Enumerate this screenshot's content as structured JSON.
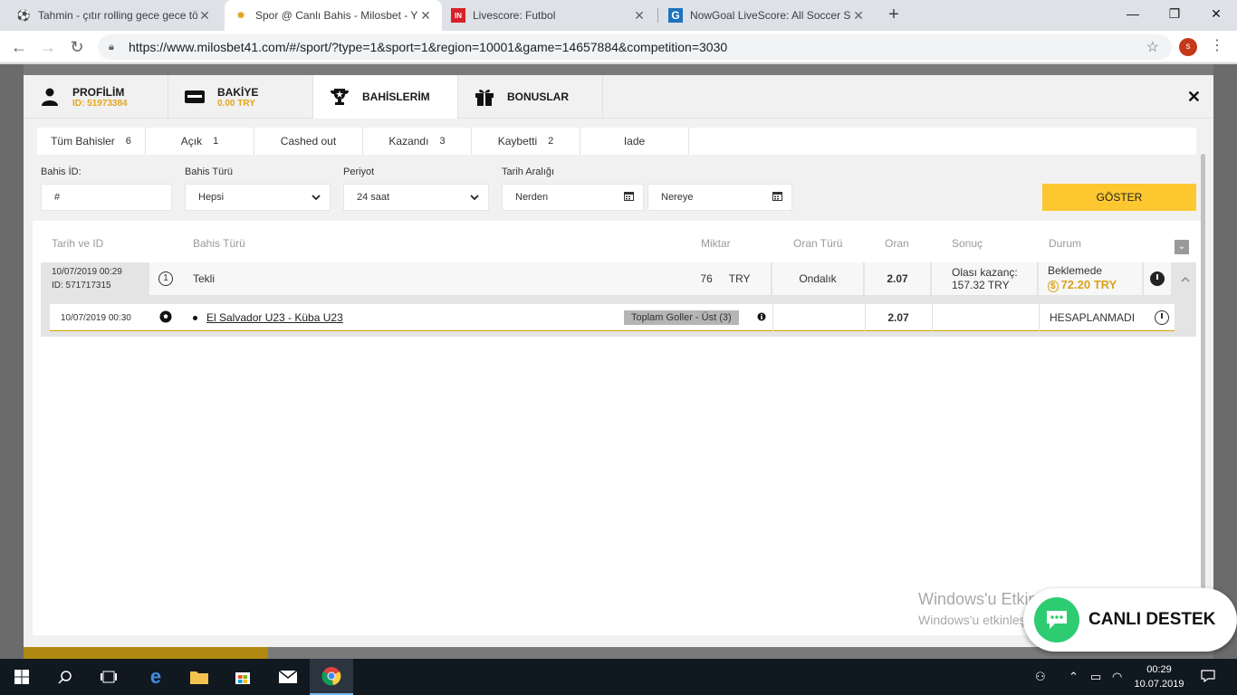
{
  "browser": {
    "tabs": [
      {
        "title": "Tahmin - çıtır rolling gece gece tö",
        "icon": "soccer-ball-icon"
      },
      {
        "title": "Spor @ Canlı Bahis - Milosbet - Y",
        "icon": "milosbet-logo-icon",
        "active": true
      },
      {
        "title": "Livescore: Futbol",
        "icon": "livescore-logo-icon"
      },
      {
        "title": "NowGoal LiveScore: All Soccer Sc",
        "icon": "nowgoal-logo-icon"
      }
    ],
    "url": "https://www.milosbet41.com/#/sport/?type=1&sport=1&region=10001&game=14657884&competition=3030",
    "profile_initial": "s"
  },
  "modal": {
    "tabs": [
      {
        "label": "PROFİLİM",
        "sub": "ID: 51973384",
        "icon": "person-icon"
      },
      {
        "label": "BAKİYE",
        "sub": "0.00 TRY",
        "icon": "wallet-icon"
      },
      {
        "label": "BAHİSLERİM",
        "sub": "",
        "icon": "trophy-icon",
        "active": true
      },
      {
        "label": "BONUSLAR",
        "sub": "",
        "icon": "gift-icon"
      }
    ],
    "filter_tabs": [
      {
        "label": "Tüm Bahisler",
        "count": "6"
      },
      {
        "label": "Açık",
        "count": "1"
      },
      {
        "label": "Cashed out",
        "count": ""
      },
      {
        "label": "Kazandı",
        "count": "3"
      },
      {
        "label": "Kaybetti",
        "count": "2"
      },
      {
        "label": "Iade",
        "count": ""
      }
    ],
    "filters": {
      "bet_id_label": "Bahis İD:",
      "bet_id_placeholder": "#",
      "bet_type_label": "Bahis Türü",
      "bet_type_value": "Hepsi",
      "period_label": "Periyot",
      "period_value": "24 saat",
      "date_range_label": "Tarih Aralığı",
      "from_placeholder": "Nerden",
      "to_placeholder": "Nereye",
      "show_button": "GÖSTER"
    },
    "table": {
      "headers": {
        "date_id": "Tarih ve ID",
        "bet_type": "Bahis Türü",
        "amount": "Miktar",
        "odds_type": "Oran Türü",
        "odds": "Oran",
        "result": "Sonuç",
        "status": "Durum"
      },
      "bet": {
        "date": "10/07/2019 00:29",
        "id": "ID: 571717315",
        "index": "1",
        "type": "Tekli",
        "amount": "76",
        "currency": "TRY",
        "odds_type": "Ondalık",
        "odds": "2.07",
        "possible_win_label": "Olası kazanç:",
        "possible_win": "157.32 TRY",
        "status": "Beklemede",
        "cashout": "72.20 TRY"
      },
      "event": {
        "date": "10/07/2019 00:30",
        "match": "El Salvador U23 - Küba U23",
        "market": "Toplam Goller - Üst (3)",
        "odds": "2.07",
        "status": "HESAPLANMADI"
      }
    }
  },
  "overlay": {
    "windows_title": "Windows'u Etkinleştir",
    "windows_sub": "Windows'u etkinleştirmek için Ayarlar'a gidin.",
    "live_support": "CANLI DESTEK"
  },
  "taskbar": {
    "time": "00:29",
    "date": "10.07.2019"
  },
  "colors": {
    "accent_yellow": "#fdc72f",
    "cashout_gold": "#d8a21b",
    "live_green": "#2ecc71"
  }
}
